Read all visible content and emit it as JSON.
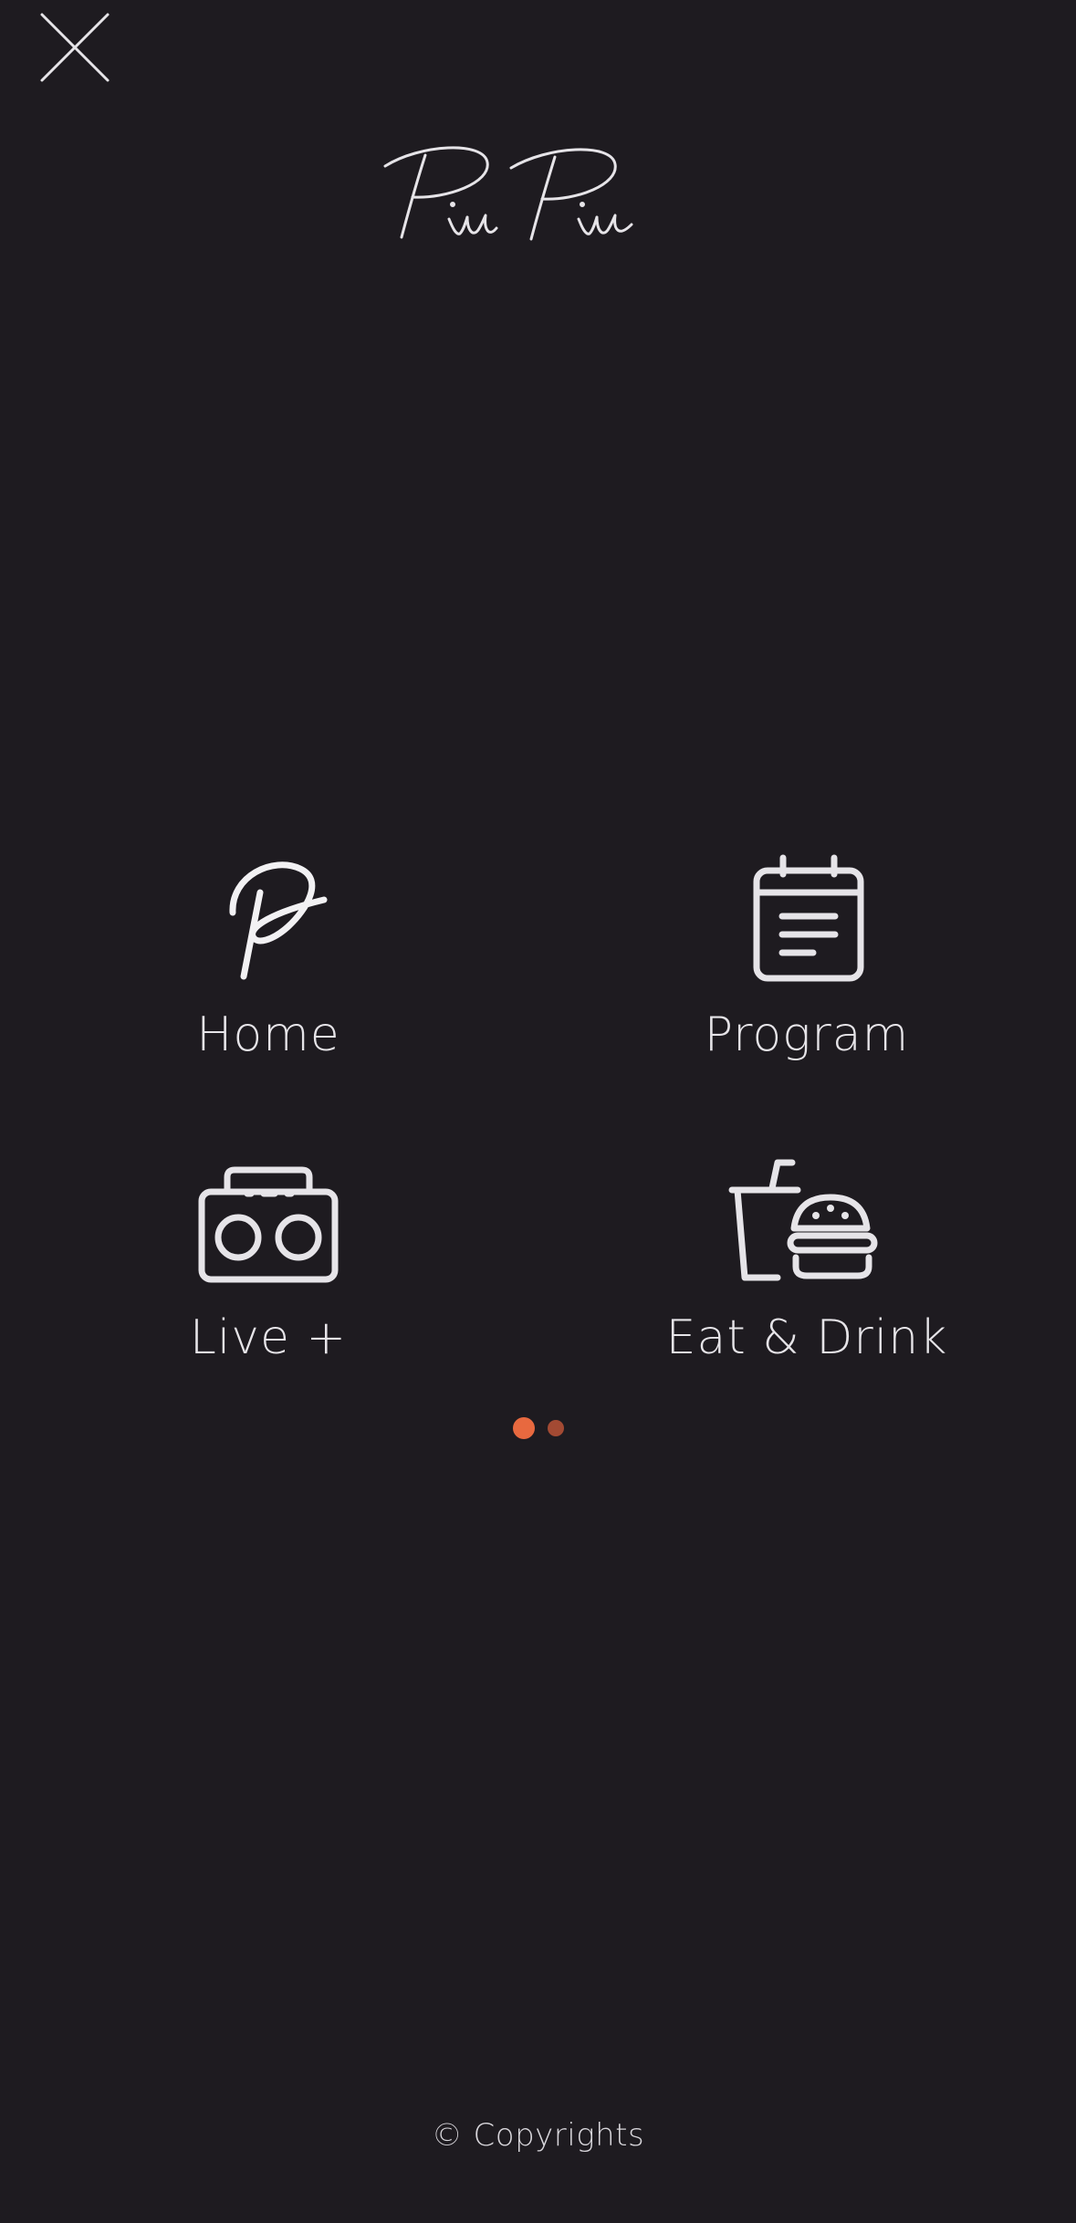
{
  "header": {
    "close_icon": "close-icon",
    "logo_text": "PiuPiu"
  },
  "menu": {
    "items": [
      {
        "id": "home",
        "label": "Home",
        "icon": "p-script-icon"
      },
      {
        "id": "program",
        "label": "Program",
        "icon": "calendar-icon"
      },
      {
        "id": "live",
        "label": "Live +",
        "icon": "boombox-icon"
      },
      {
        "id": "eat",
        "label": "Eat & Drink",
        "icon": "drink-burger-icon"
      }
    ]
  },
  "pager": {
    "pages": 2,
    "current": 1,
    "active_color": "#e8693f",
    "inactive_color": "#a34a33"
  },
  "footer": {
    "text": "© Copyrights"
  },
  "colors": {
    "background": "#1e1b20",
    "foreground": "#e6e4e8"
  }
}
